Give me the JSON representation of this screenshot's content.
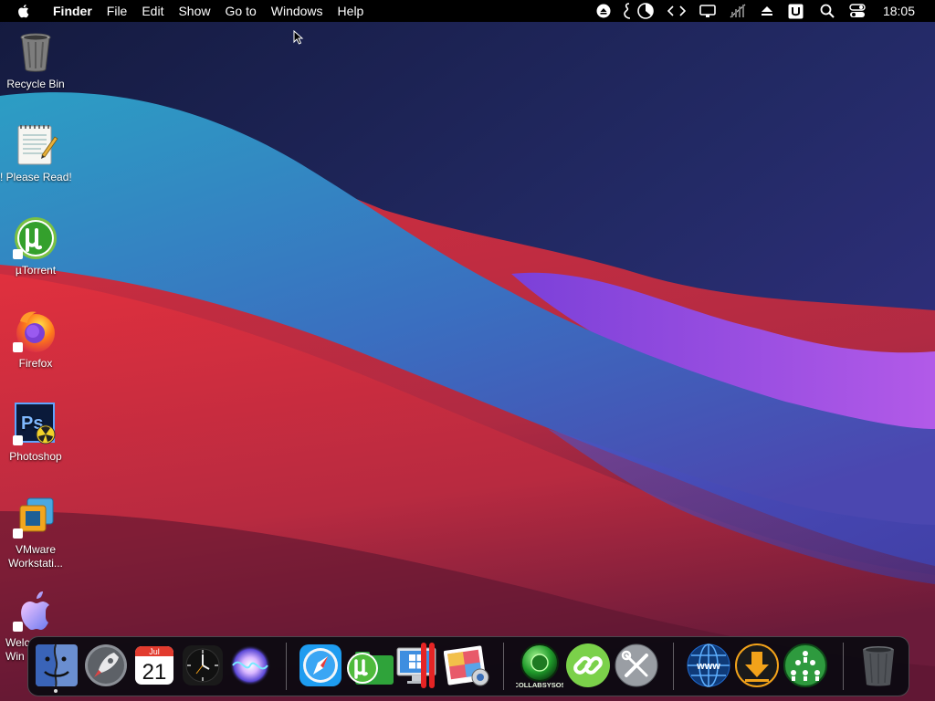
{
  "menubar": {
    "app_name": "Finder",
    "menus": [
      "File",
      "Edit",
      "Show",
      "Go to",
      "Windows",
      "Help"
    ],
    "status_icons": [
      "eject-icon",
      "script-icon",
      "pie-chart-icon",
      "code-brackets-icon",
      "display-icon",
      "mute-icon",
      "upload-icon",
      "u-badge-icon",
      "search-icon",
      "control-center-icon"
    ],
    "clock": "18:05"
  },
  "desktop": {
    "icons": [
      {
        "label": "Recycle Bin",
        "icon": "recycle-bin-icon"
      },
      {
        "label": "! Please Read!",
        "icon": "notepad-icon"
      },
      {
        "label": "µTorrent",
        "icon": "utorrent-icon"
      },
      {
        "label": "Firefox",
        "icon": "firefox-icon"
      },
      {
        "label": "Photoshop",
        "icon": "photoshop-icon"
      },
      {
        "label": "VMware Workstati...",
        "label_line1": "VMware",
        "label_line2": "Workstati...",
        "icon": "vmware-icon"
      },
      {
        "label": "Welc... Win...",
        "label_line1": "Welc",
        "label_line2": "Win",
        "icon": "apple-welcome-icon"
      }
    ]
  },
  "dock": {
    "calendar_month": "Jul",
    "calendar_day": "21",
    "collabsysos_label": "COLLABSYSOS",
    "photoshop_ps": "Ps",
    "items": [
      "finder",
      "launchpad",
      "calendar",
      "clock",
      "siri",
      "safari",
      "utorrent",
      "boot-camp",
      "image-capture",
      "collabsysos",
      "link",
      "system-tools",
      "www-globe",
      "downloader",
      "network",
      "trash"
    ]
  }
}
